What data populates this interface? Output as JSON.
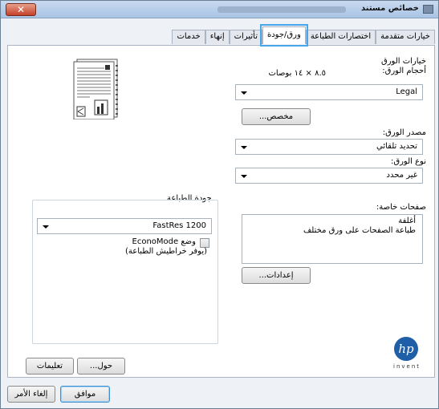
{
  "window": {
    "title": "خصائص مستند",
    "close_label": "✕"
  },
  "tabs": [
    {
      "label": "خيارات متقدمة",
      "active": false
    },
    {
      "label": "اختصارات الطباعة",
      "active": false
    },
    {
      "label": "ورق/جودة",
      "active": true
    },
    {
      "label": "تأثيرات",
      "active": false
    },
    {
      "label": "إنهاء",
      "active": false
    },
    {
      "label": "خدمات",
      "active": false
    }
  ],
  "paper": {
    "options_heading": "خيارات الورق",
    "size_label": "أحجام الورق:",
    "size_dims": "٨.٥ × ١٤ بوصات",
    "size_value": "Legal",
    "custom_button": "مخصص...",
    "source_label": "مصدر الورق:",
    "source_value": "تحديد تلقائي",
    "type_label": "نوع الورق:",
    "type_value": "غير محدد"
  },
  "special_pages": {
    "label": "صفحات خاصة:",
    "items": [
      "أغلفة",
      "طباعة الصفحات على ورق مختلف"
    ],
    "settings_button": "إعدادات..."
  },
  "print_quality": {
    "label": "جودة الطباعة",
    "value": "FastRes 1200",
    "econo_label_1": "وضع EconoMode",
    "econo_label_2": "(يوفر خراطيش الطباعة)",
    "econo_checked": false
  },
  "bottom": {
    "about_button": "حول...",
    "help_button": "تعليمات",
    "logo_text": "invent"
  },
  "footer": {
    "ok_button": "موافق",
    "cancel_button": "إلغاء الأمر"
  },
  "colors": {
    "active_tab_outline": "#49a6e8",
    "hp_blue": "#1f5fa8"
  }
}
